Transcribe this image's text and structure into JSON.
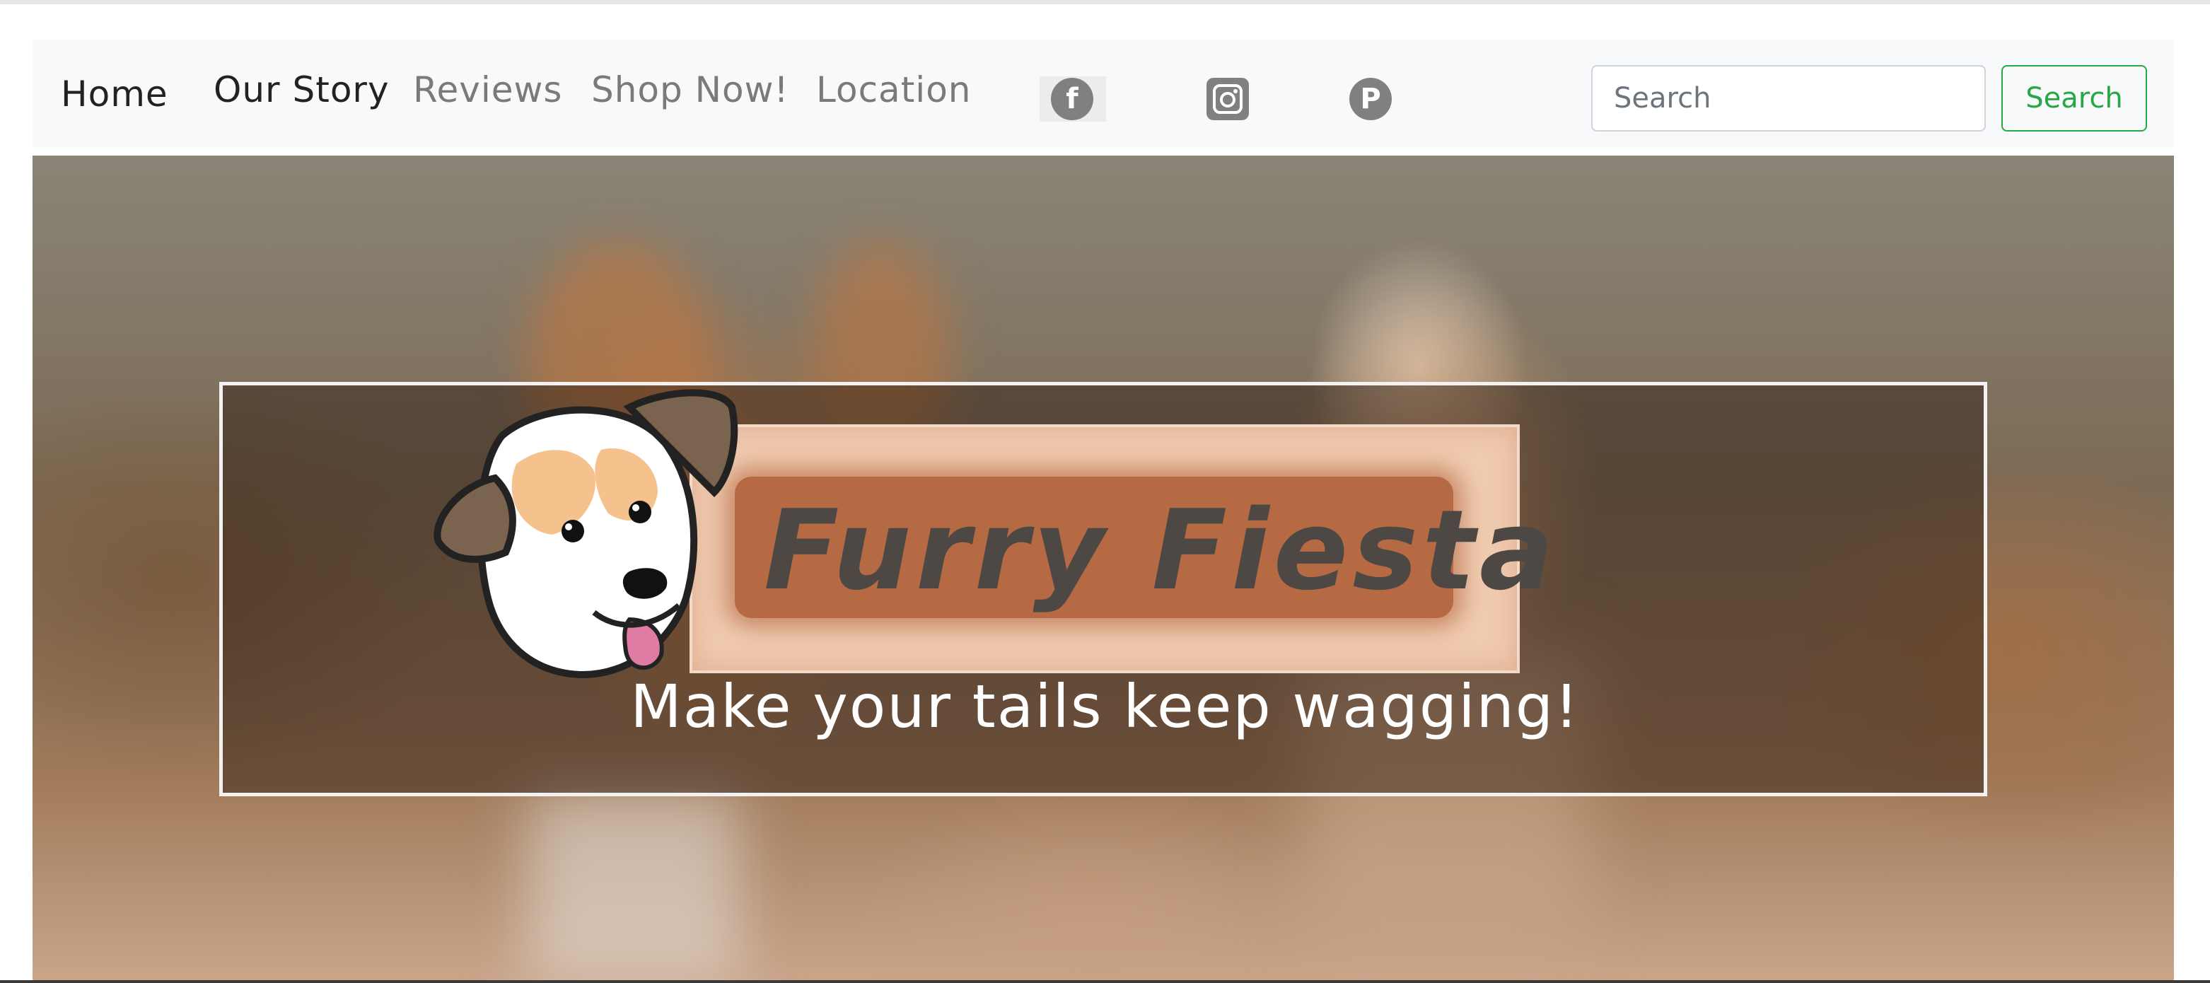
{
  "nav": {
    "links": [
      {
        "label": "Home"
      },
      {
        "label": "Our Story"
      },
      {
        "label": "Reviews"
      },
      {
        "label": "Shop Now!"
      },
      {
        "label": "Location"
      }
    ],
    "social": [
      {
        "icon": "facebook-icon",
        "glyph": "f"
      },
      {
        "icon": "instagram-icon"
      },
      {
        "icon": "pinterest-icon",
        "glyph": "P"
      }
    ]
  },
  "search": {
    "placeholder": "Search",
    "button_label": "Search"
  },
  "hero": {
    "brand": "Furry Fiesta",
    "tagline": "Make your tails keep wagging!"
  },
  "colors": {
    "accent": "#28a745",
    "navbar_bg": "#f8f9fa",
    "logo_plate": "#b56a44"
  }
}
